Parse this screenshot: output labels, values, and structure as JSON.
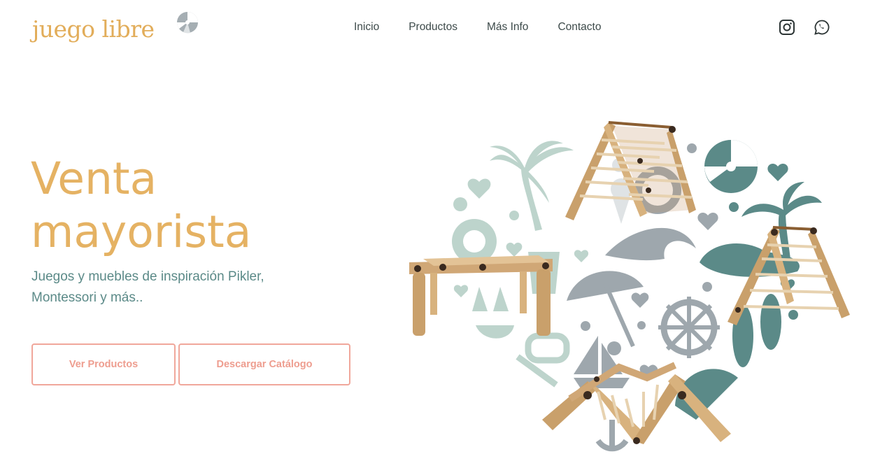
{
  "brand": {
    "logo_text": "juego libre",
    "logo_icon": "beach-ball-icon"
  },
  "nav": {
    "items": [
      {
        "label": "Inicio"
      },
      {
        "label": "Productos"
      },
      {
        "label": "Más Info"
      },
      {
        "label": "Contacto"
      }
    ]
  },
  "social": {
    "instagram_icon": "instagram-icon",
    "whatsapp_icon": "whatsapp-icon"
  },
  "hero": {
    "title_line1": "Venta",
    "title_line2": "mayorista",
    "subtitle_line1": "Juegos y muebles de inspiración Pikler,",
    "subtitle_line2": "Montessori y más.."
  },
  "buttons": {
    "primary": "Ver Productos",
    "secondary": "Descargar Catálogo"
  },
  "colors": {
    "brand_gold": "#e5b263",
    "teal": "#5b8a88",
    "coral": "#f0a79b",
    "gray_icons": "#9ea7ad",
    "mint": "#bdd4cc"
  }
}
